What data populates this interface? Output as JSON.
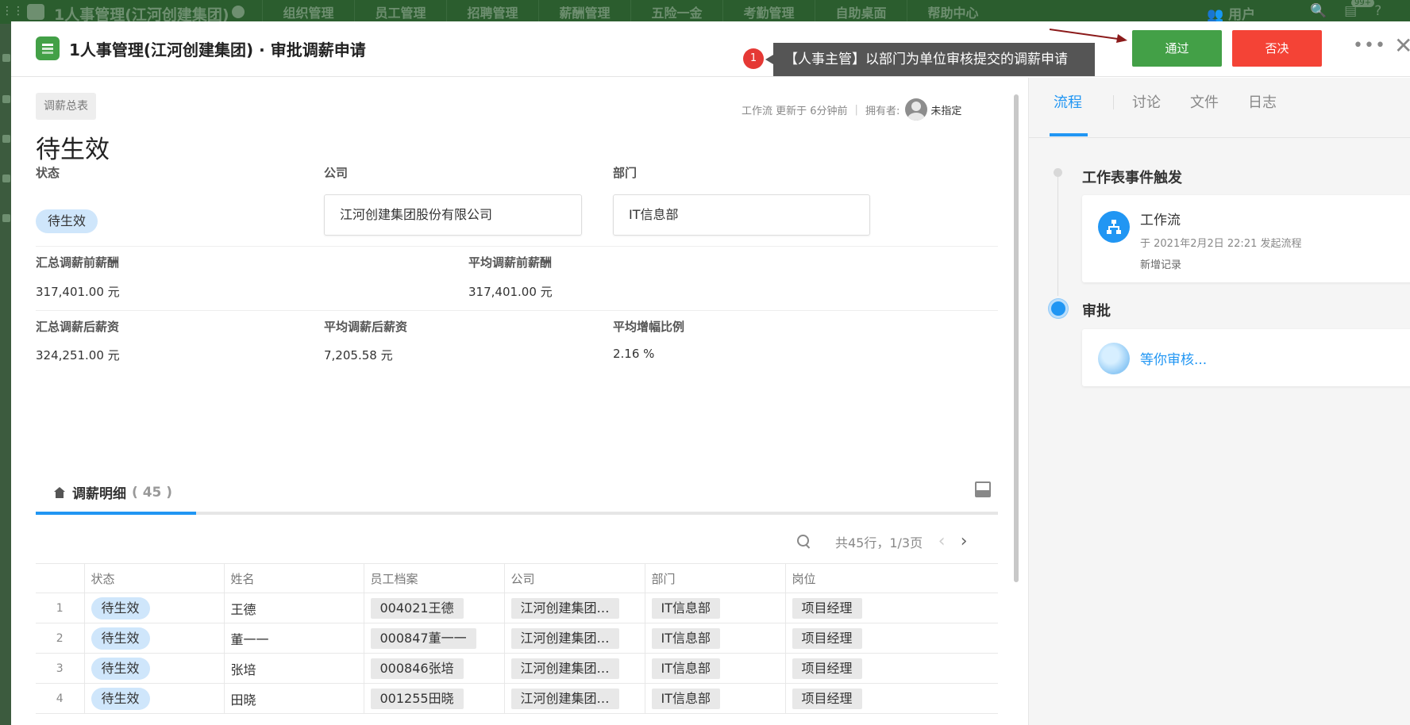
{
  "background": {
    "app_title": "1人事管理(江河创建集团)",
    "nav": [
      "组织管理",
      "员工管理",
      "招聘管理",
      "薪酬管理",
      "五险一金",
      "考勤管理",
      "自助桌面",
      "帮助中心"
    ],
    "user_label": "用户",
    "badge": "99+"
  },
  "header": {
    "title": "1人事管理(江河创建集团) · 审批调薪申请",
    "step_number": "1",
    "hint": "【人事主管】以部门为单位审核提交的调薪申请",
    "pass_label": "通过",
    "reject_label": "否决"
  },
  "record": {
    "sheet_tag": "调薪总表",
    "meta_updated": "工作流 更新于 6分钟前",
    "meta_owner_label": "拥有者:",
    "meta_owner": "未指定",
    "title": "待生效",
    "status_label": "状态",
    "status_value": "待生效",
    "company_label": "公司",
    "company_value": "江河创建集团股份有限公司",
    "dept_label": "部门",
    "dept_value": "IT信息部",
    "total_before_label": "汇总调薪前薪酬",
    "total_before_value": "317,401.00 元",
    "avg_before_label": "平均调薪前薪酬",
    "avg_before_value": "317,401.00 元",
    "total_after_label": "汇总调薪后薪资",
    "total_after_value": "324,251.00 元",
    "avg_after_label": "平均调薪后薪资",
    "avg_after_value": "7,205.58 元",
    "avg_rate_label": "平均增幅比例",
    "avg_rate_value": "2.16 %"
  },
  "detail": {
    "tab_label": "调薪明细",
    "tab_count": "( 45 )",
    "pager_text": "共45行，1/3页",
    "columns": [
      "状态",
      "姓名",
      "员工档案",
      "公司",
      "部门",
      "岗位"
    ],
    "rows": [
      {
        "num": "1",
        "status": "待生效",
        "name": "王德",
        "file": "004021王德",
        "company": "江河创建集团…",
        "dept": "IT信息部",
        "post": "项目经理"
      },
      {
        "num": "2",
        "status": "待生效",
        "name": "董一一",
        "file": "000847董一一",
        "company": "江河创建集团…",
        "dept": "IT信息部",
        "post": "项目经理"
      },
      {
        "num": "3",
        "status": "待生效",
        "name": "张培",
        "file": "000846张培",
        "company": "江河创建集团…",
        "dept": "IT信息部",
        "post": "项目经理"
      },
      {
        "num": "4",
        "status": "待生效",
        "name": "田晓",
        "file": "001255田晓",
        "company": "江河创建集团…",
        "dept": "IT信息部",
        "post": "项目经理"
      }
    ]
  },
  "side": {
    "tabs": [
      "流程",
      "讨论",
      "文件",
      "日志"
    ],
    "event_title": "工作表事件触发",
    "wf_name": "工作流",
    "wf_time": "于 2021年2月2日 22:21 发起流程",
    "wf_action": "新增记录",
    "approve_title": "审批",
    "waiting": "等你审核..."
  },
  "colors": {
    "pass": "#43a047",
    "reject": "#f44336",
    "accent": "#2196f3",
    "status_pill": "#cfe6fb"
  }
}
